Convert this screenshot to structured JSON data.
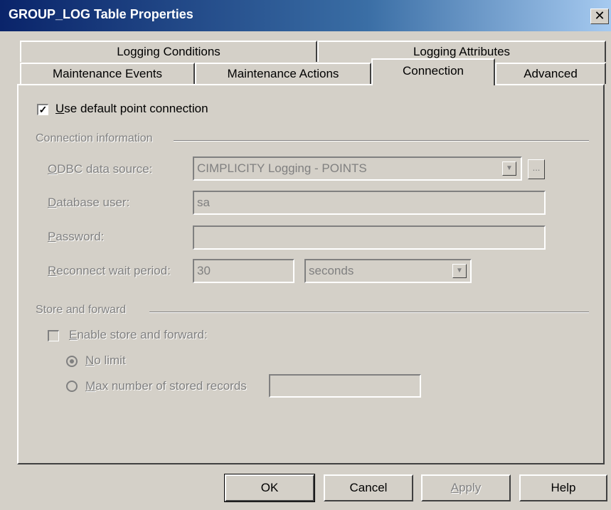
{
  "window": {
    "title": "GROUP_LOG Table Properties",
    "close_glyph": "✕"
  },
  "tabs": {
    "row1": [
      "Logging Conditions",
      "Logging Attributes"
    ],
    "row2": [
      "Maintenance Events",
      "Maintenance Actions",
      "Connection",
      "Advanced"
    ],
    "active": "Connection"
  },
  "connection": {
    "use_default_label": "Use default point connection",
    "use_default_checked": true,
    "group_label": "Connection information",
    "odbc_label": "ODBC data source:",
    "odbc_value": "CIMPLICITY Logging - POINTS",
    "browse_label": "...",
    "db_user_label": "Database user:",
    "db_user_value": "sa",
    "password_label": "Password:",
    "password_value": "",
    "reconnect_label": "Reconnect wait period:",
    "reconnect_value": "30",
    "reconnect_unit": "seconds"
  },
  "store_forward": {
    "group_label": "Store and forward",
    "enable_label": "Enable store and forward:",
    "enable_checked": false,
    "no_limit_label": "No limit",
    "max_records_label": "Max number of stored records",
    "max_records_value": "",
    "selected": "No limit"
  },
  "buttons": {
    "ok": "OK",
    "cancel": "Cancel",
    "apply": "Apply",
    "help": "Help"
  },
  "colors": {
    "titlebar": "#0a246a",
    "face": "#d4d0c8",
    "disabled_text": "#808080"
  }
}
